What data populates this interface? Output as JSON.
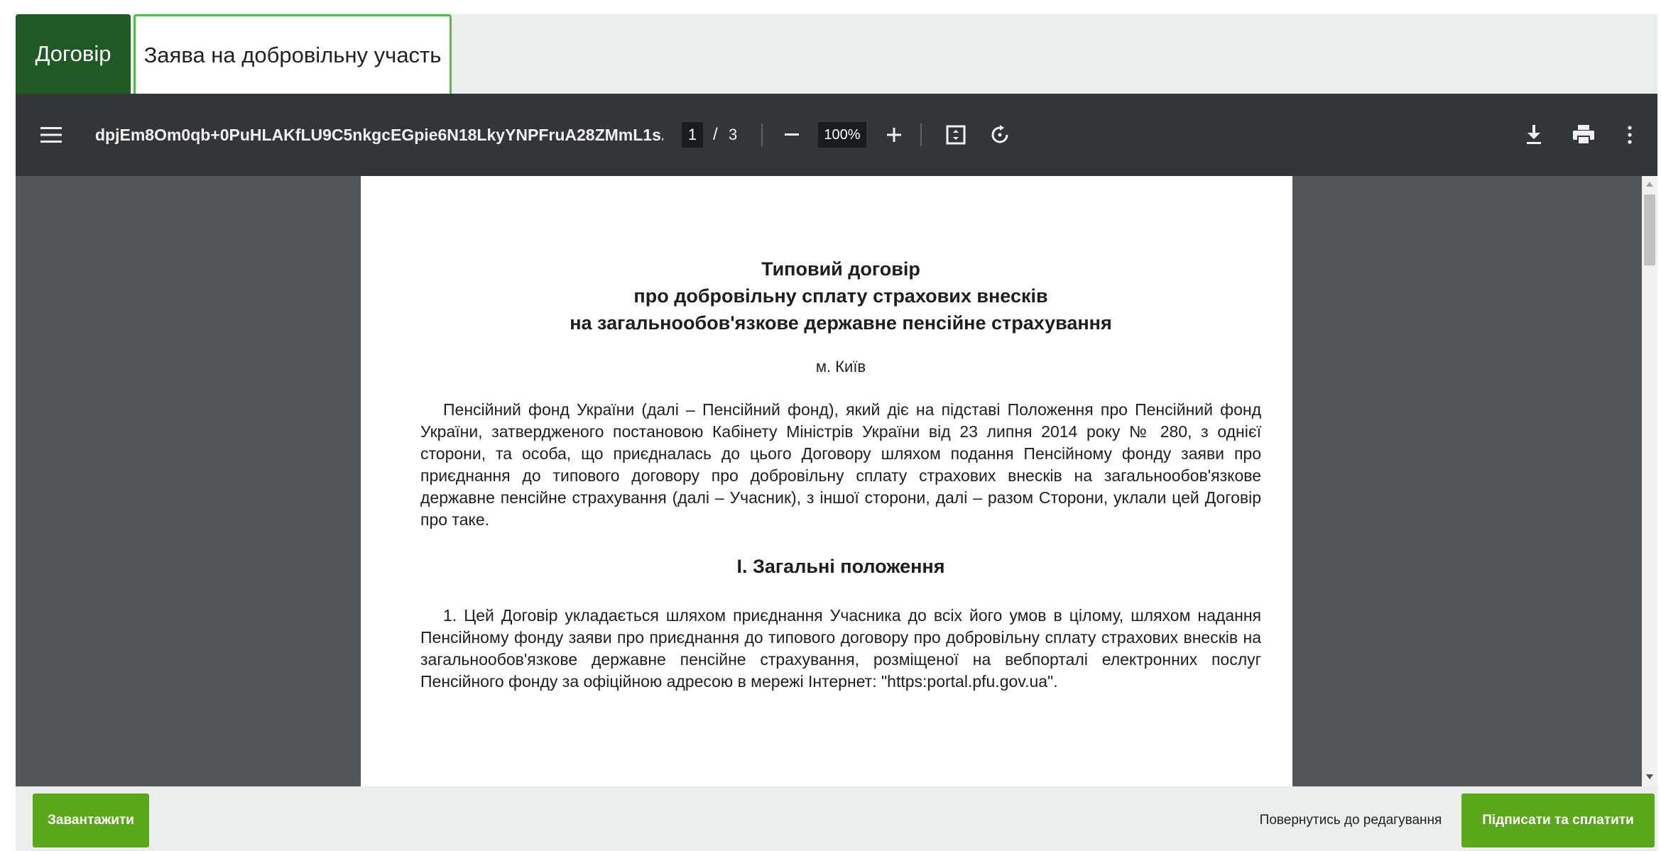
{
  "tabs": [
    {
      "label": "Договір",
      "active": true
    },
    {
      "label": "Заява на добровільну участь",
      "active": false
    }
  ],
  "viewer": {
    "file_name": "dpjEm8Om0qb+0PuHLAKfLU9C5nkgcEGpie6N18LkyYNPFruA28ZMmL1s...",
    "current_page": "1",
    "page_separator": "/",
    "total_pages": "3",
    "zoom": "100%",
    "icons": {
      "menu": "hamburger-menu-icon",
      "zoom_out": "minus-icon",
      "zoom_in": "plus-icon",
      "fit": "fit-page-icon",
      "rotate": "rotate-icon",
      "download": "download-icon",
      "print": "print-icon",
      "more": "more-vertical-icon"
    }
  },
  "document": {
    "title_lines": [
      "Типовий договір",
      "про добровільну сплату страхових внесків",
      "на загальнообов'язкове державне пенсійне страхування"
    ],
    "city": "м. Київ",
    "intro": "Пенсійний фонд України (далі – Пенсійний фонд), який діє на підставі Положення про Пенсійний фонд України, затвердженого постановою Кабінету Міністрів України від 23 липня 2014 року № 280, з однієї сторони, та особа, що приєдналась до цього Договору шляхом подання Пенсійному фонду заяви про приєднання до типового договору про добровільну сплату страхових внесків на загальнообов'язкове державне пенсійне страхування (далі – Учасник), з іншої сторони, далі – разом Сторони, уклали цей Договір про таке.",
    "section_title": "І. Загальні положення",
    "clause_1": "1. Цей Договір укладається шляхом приєднання Учасника до всіх його умов в цілому, шляхом надання Пенсійному фонду заяви про приєднання до типового договору про добровільну сплату страхових внесків на загальнообов'язкове державне пенсійне страхування, розміщеної на вебпорталі електронних послуг Пенсійного фонду за офіційною адресою в мережі Інтернет: \"https:portal.pfu.gov.ua\"."
  },
  "actions": {
    "download_label": "Завантажити",
    "back_label": "Повернутись до редагування",
    "sign_label": "Підписати та сплатити"
  },
  "colors": {
    "active_tab": "#1f5a24",
    "tab_border": "#4fbf4a",
    "primary_button": "#5aa81a",
    "toolbar": "#323639",
    "viewer_bg": "#525659"
  }
}
